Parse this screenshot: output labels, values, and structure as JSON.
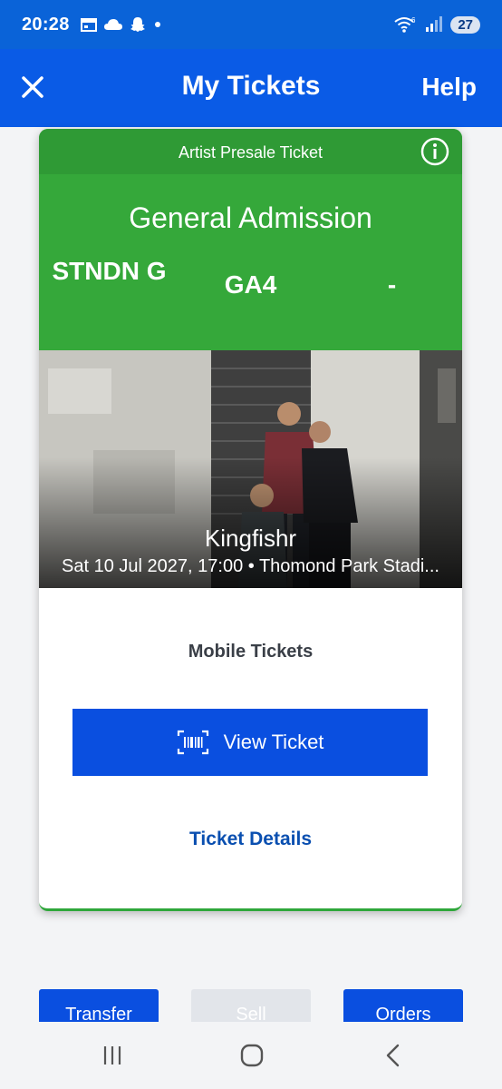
{
  "status_bar": {
    "time": "20:28",
    "battery": "27",
    "wifi_badge": "6"
  },
  "header": {
    "title": "My Tickets",
    "help": "Help"
  },
  "ticket": {
    "presale_label": "Artist Presale Ticket",
    "admission_type": "General Admission",
    "section": "STNDN G",
    "row": "GA4",
    "seat": "-",
    "event_name": "Kingfishr",
    "event_date": "Sat 10 Jul 2027, 17:00 • Thomond Park Stadi...",
    "mobile_label": "Mobile Tickets",
    "view_ticket": "View Ticket",
    "ticket_details": "Ticket Details"
  },
  "actions": {
    "transfer": "Transfer",
    "sell": "Sell",
    "orders": "Orders"
  },
  "colors": {
    "status_bar": "#0a63d8",
    "header": "#0a5be6",
    "ticket_green": "#35a83a",
    "primary_button": "#0a4fe0",
    "link": "#0a4fb0"
  }
}
